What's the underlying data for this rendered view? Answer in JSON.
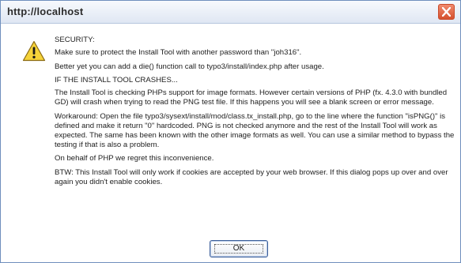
{
  "window": {
    "title": "http://localhost"
  },
  "icons": {
    "warning": "warning-icon",
    "close": "close-icon"
  },
  "message": {
    "security_header": "SECURITY:",
    "security_line1": "Make sure to protect the Install Tool with another password than \"joh316\".",
    "security_line2": "Better yet you can add a die() function call to typo3/install/index.php after usage.",
    "crash_header": "IF THE INSTALL TOOL CRASHES...",
    "crash_paragraph": "The Install Tool is checking PHPs support for image formats. However certain versions of PHP (fx. 4.3.0 with bundled GD) will crash when trying to read the PNG test file. If this happens you will see a blank screen or error message.",
    "workaround_paragraph": "Workaround: Open the file typo3/sysext/install/mod/class.tx_install.php, go to the line where the function \"isPNG()\" is defined and make it return \"0\" hardcoded. PNG is not checked anymore and the rest of the Install Tool will work as expected. The same has been known with the other image formats as well. You can use a similar method to bypass the testing if that is also a problem.",
    "regret_line": "On behalf of PHP we regret this inconvenience.",
    "btw_paragraph": "BTW: This Install Tool will only work if cookies are accepted by your web browser. If this dialog pops up over and over again you didn't enable cookies."
  },
  "buttons": {
    "ok_label": "OK"
  },
  "colors": {
    "close_button": "#d5502d",
    "titlebar": "#dfe7f3",
    "warning_fill": "#f5d33a"
  }
}
